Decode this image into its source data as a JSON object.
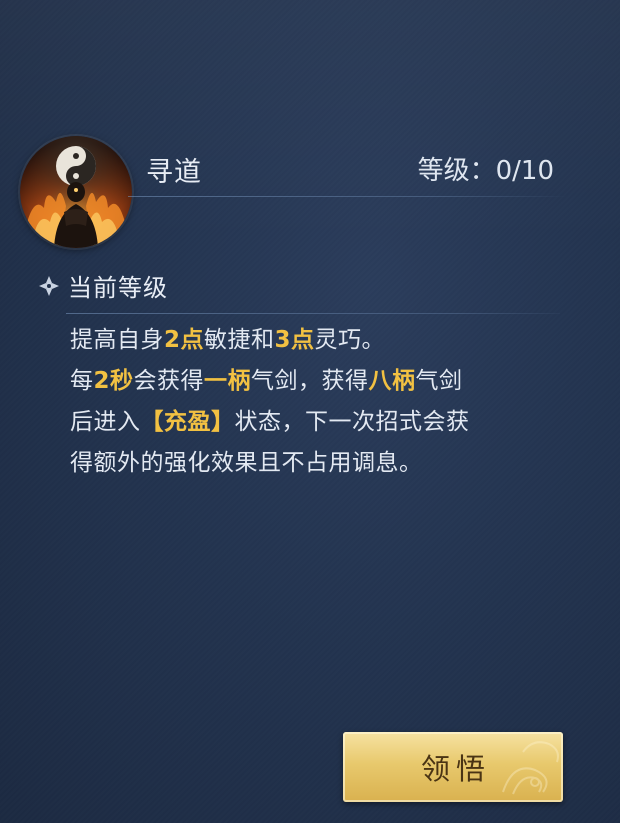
{
  "skill": {
    "name": "寻道",
    "level_label": "等级：",
    "level_value": "0/10",
    "icon": "taiji-cultivator-icon"
  },
  "section": {
    "icon": "diamond-ornament-icon",
    "title": "当前等级"
  },
  "description": {
    "line1": {
      "a": "提高自身",
      "b": "2点",
      "c": "敏捷和",
      "d": "3点",
      "e": "灵巧。"
    },
    "line2": {
      "a": "每",
      "b": "2秒",
      "c": "会获得",
      "d": "一柄",
      "e": "气剑，获得",
      "f": "八柄",
      "g": "气剑"
    },
    "line3": {
      "a": "后进入",
      "b": "【充盈】",
      "c": "状态，下一次招式会获"
    },
    "line4": {
      "a": "得额外的强化效果且不占用调息。"
    }
  },
  "button": {
    "label": "领悟"
  },
  "colors": {
    "background": "#233450",
    "highlight": "#f2c142",
    "text": "#e3e9f2",
    "button": "#e8c96d"
  }
}
